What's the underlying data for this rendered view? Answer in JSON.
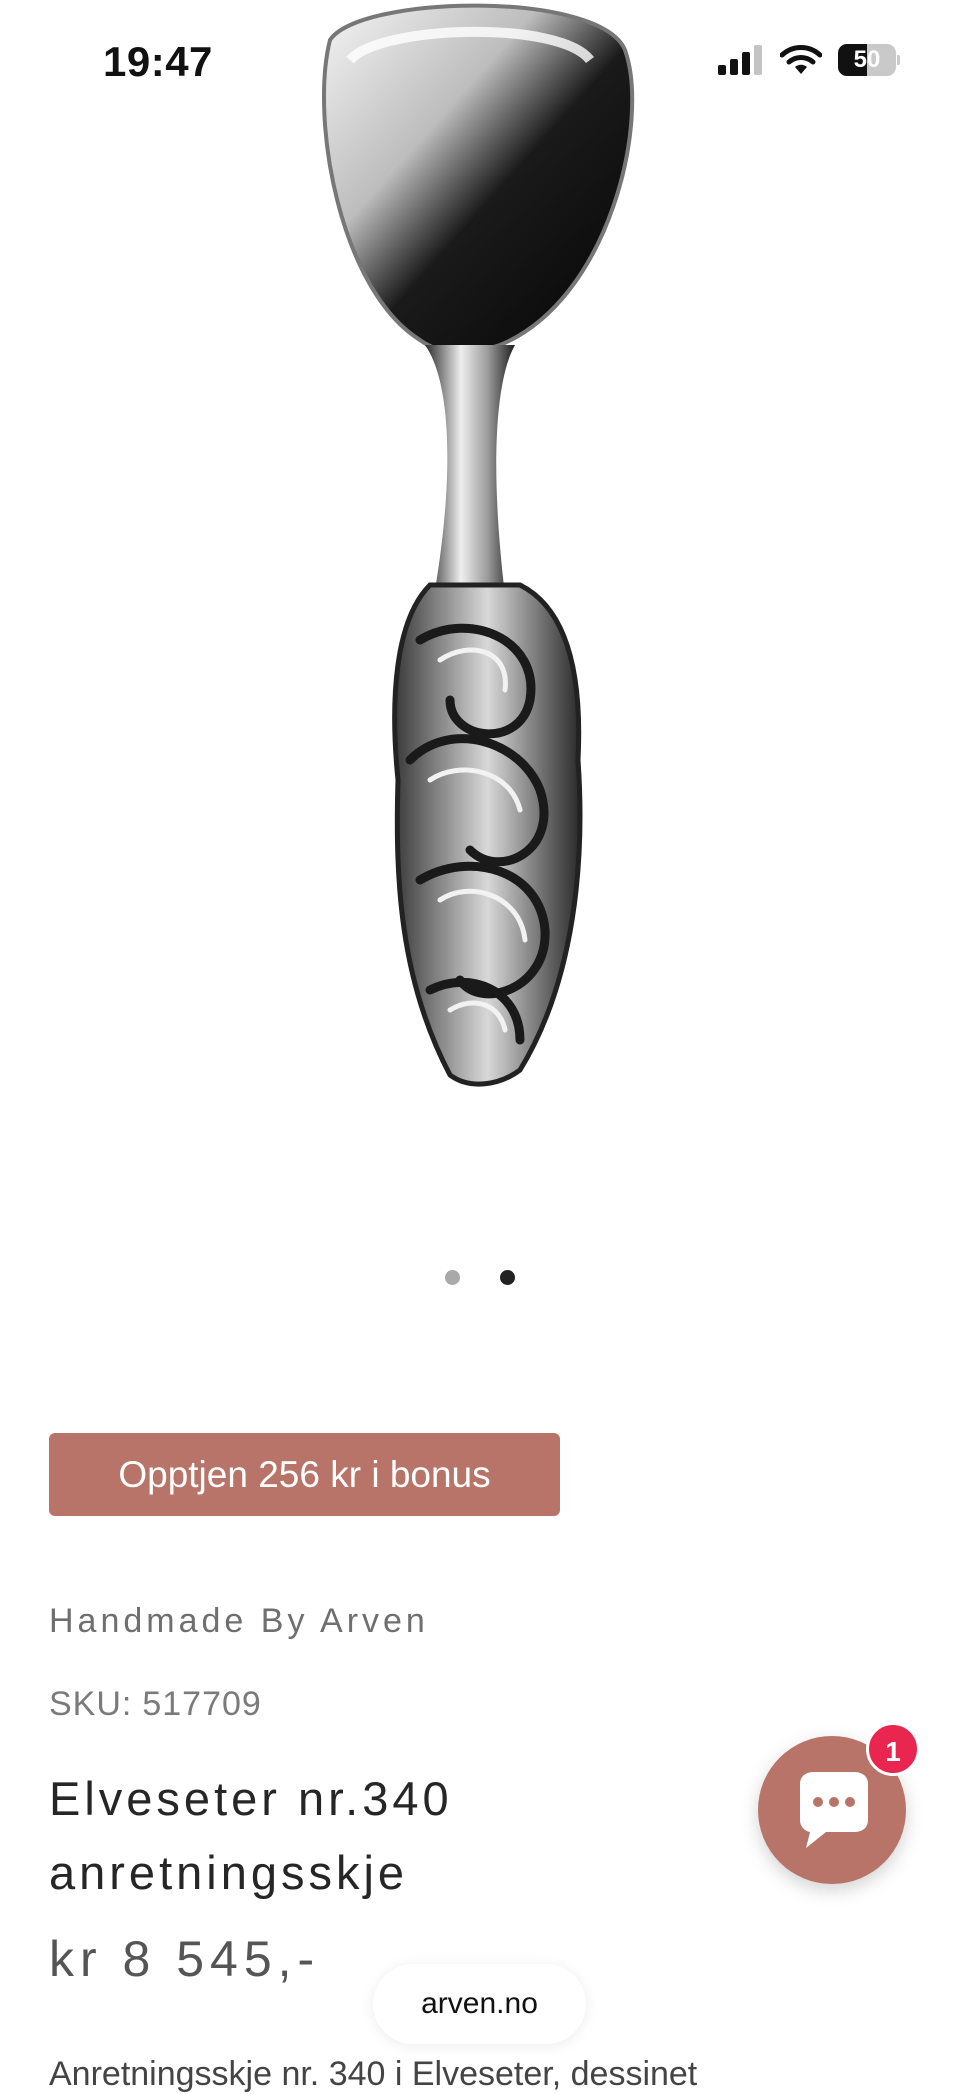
{
  "status_bar": {
    "time": "19:47",
    "battery": "50",
    "battery_fraction": 0.5
  },
  "gallery": {
    "image_icon": "ornate-silver-serving-spoon",
    "active_index": 1,
    "dots": [
      {
        "color": "#a9a9a9"
      },
      {
        "color": "#222222"
      }
    ]
  },
  "bonus_button": "Opptjen 256 kr i bonus",
  "product": {
    "brand": "Handmade By Arven",
    "sku_label": "SKU:",
    "sku": "517709",
    "title_line1": "Elveseter nr.340",
    "title_line2": "anretningsskje",
    "price": "kr 8 545,-",
    "description_peek": "Anretningsskje nr. 340 i Elveseter, dessinet"
  },
  "chat": {
    "icon": "chat-bubble-icon",
    "badge_count": "1"
  },
  "browser": {
    "url": "arven.no"
  },
  "colors": {
    "accent": "#b87468",
    "badge": "#e8264f"
  }
}
